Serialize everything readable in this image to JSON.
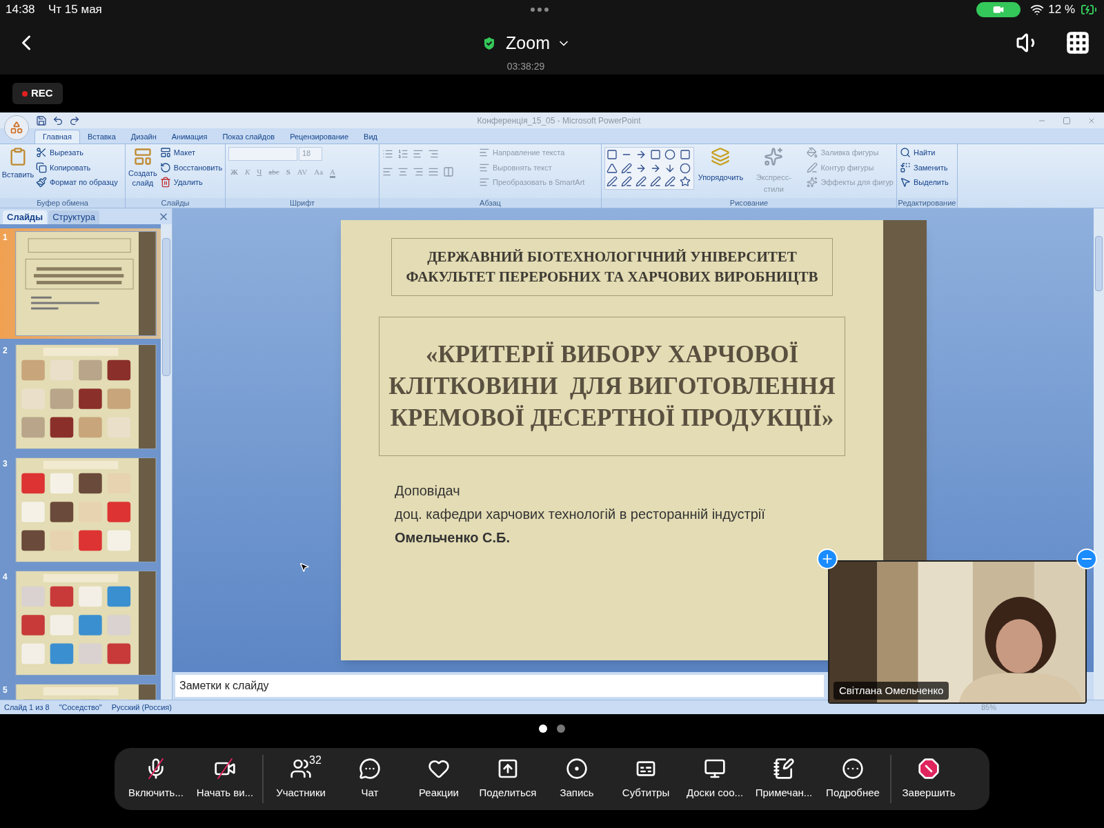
{
  "status_bar": {
    "time": "14:38",
    "date": "Чт 15 мая",
    "battery": "12 %"
  },
  "header": {
    "title": "Zoom",
    "elapsed": "03:38:29"
  },
  "recording": {
    "label": "REC"
  },
  "powerpoint": {
    "window_title": "Конференція_15_05 - Microsoft PowerPoint",
    "tabs": [
      {
        "label": "Главная",
        "selected": true
      },
      {
        "label": "Вставка",
        "selected": false
      },
      {
        "label": "Дизайн",
        "selected": false
      },
      {
        "label": "Анимация",
        "selected": false
      },
      {
        "label": "Показ слайдов",
        "selected": false
      },
      {
        "label": "Рецензирование",
        "selected": false
      },
      {
        "label": "Вид",
        "selected": false
      }
    ],
    "clipboard": {
      "paste": "Вставить",
      "items": [
        "Вырезать",
        "Копировать",
        "Формат по образцу"
      ],
      "label": "Буфер обмена"
    },
    "slides_group": {
      "new_slide": [
        "Создать",
        "слайд"
      ],
      "items": [
        "Макет",
        "Восстановить",
        "Удалить"
      ],
      "label": "Слайды"
    },
    "font_group": {
      "size": "18",
      "buttons": [
        {
          "label": "Ж",
          "kind": "bold"
        },
        {
          "label": "К",
          "kind": "italic"
        },
        {
          "label": "Ч",
          "kind": "underline"
        },
        {
          "label": "abc",
          "kind": "strike"
        },
        {
          "label": "S",
          "kind": "shadow"
        },
        {
          "label": "AV",
          "kind": "spacing"
        },
        {
          "label": "Aa",
          "kind": "case"
        },
        {
          "label": "A",
          "kind": "color"
        }
      ],
      "label": "Шрифт"
    },
    "paragraph_group": {
      "items": [
        "Направление текста",
        "Выровнять текст",
        "Преобразовать в SmartArt"
      ],
      "label": "Абзац"
    },
    "drawing_group": {
      "arrange": "Упорядочить",
      "styles": "Экспресс-стили",
      "items": [
        "Заливка фигуры",
        "Контур фигуры",
        "Эффекты для фигур"
      ],
      "label": "Рисование"
    },
    "editing_group": {
      "items": [
        "Найти",
        "Заменить",
        "Выделить"
      ],
      "label": "Редактирование"
    },
    "pane_tabs": [
      {
        "label": "Слайды",
        "selected": true
      },
      {
        "label": "Структура",
        "selected": false
      }
    ],
    "thumbnails": [
      {
        "number": "1",
        "selected": true
      },
      {
        "number": "2",
        "selected": false
      },
      {
        "number": "3",
        "selected": false
      },
      {
        "number": "4",
        "selected": false
      },
      {
        "number": "5",
        "selected": false
      }
    ],
    "slide": {
      "header": [
        "ДЕРЖАВНИЙ БІОТЕХНОЛОГІЧНИЙ УНІВЕРСИТЕТ",
        "ФАКУЛЬТЕТ ПЕРЕРОБНИХ ТА ХАРЧОВИХ ВИРОБНИЦТВ"
      ],
      "title": [
        "«КРИТЕРІЇ ВИБОРУ ХАРЧОВОЇ",
        "КЛІТКОВИНИ  ДЛЯ ВИГОТОВЛЕННЯ",
        "КРЕМОВОЇ ДЕСЕРТНОЇ ПРОДУКЦІЇ»"
      ],
      "speaker": [
        {
          "text": "Доповідач",
          "bold": false
        },
        {
          "text": "доц. кафедри харчових технологій в ресторанній індустрії",
          "bold": false
        },
        {
          "text": "Омельченко С.Б.",
          "bold": true
        }
      ]
    },
    "notes_placeholder": "Заметки к слайду",
    "status": [
      "Слайд 1 из 8",
      "\"Соседство\"",
      "Русский (Россия)"
    ],
    "zoom": "85%"
  },
  "video": {
    "name": "Світлана Омельченко"
  },
  "pages": [
    {
      "selected": true
    },
    {
      "selected": false
    }
  ],
  "toolbar": [
    {
      "label": "Включить...",
      "off": true
    },
    {
      "label": "Начать ви...",
      "off": true
    },
    {
      "label": "Участники",
      "badge": "32"
    },
    {
      "label": "Чат"
    },
    {
      "label": "Реакции"
    },
    {
      "label": "Поделиться"
    },
    {
      "label": "Запись"
    },
    {
      "label": "Субтитры"
    },
    {
      "label": "Доски соо..."
    },
    {
      "label": "Примечан..."
    },
    {
      "label": "Подробнее"
    },
    {
      "label": "Завершить",
      "kind": "danger"
    }
  ]
}
